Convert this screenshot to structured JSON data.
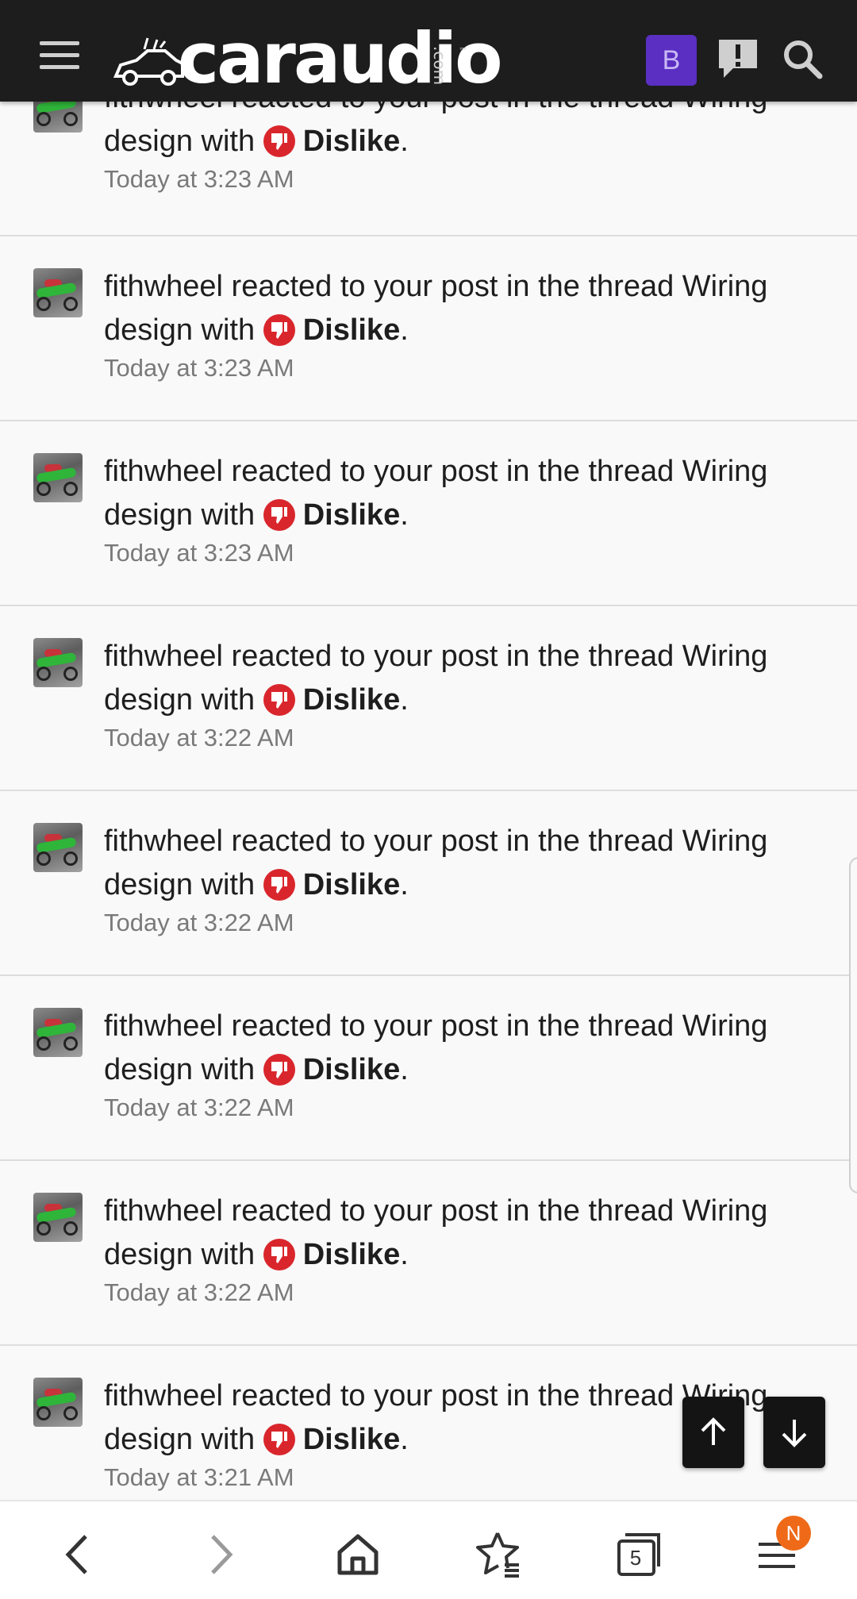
{
  "header": {
    "logo_text": "caraudio",
    "logo_suffix": ".com",
    "logo_tm": "™",
    "user_initial": "B",
    "icons": [
      "menu-icon",
      "alert-icon",
      "search-icon"
    ]
  },
  "notifications": [
    {
      "text": "fithwheel reacted to your post in the thread Wiring design with",
      "reaction": "Dislike",
      "time": "Today at 3:23 AM"
    },
    {
      "text": "fithwheel reacted to your post in the thread Wiring design with",
      "reaction": "Dislike",
      "time": "Today at 3:23 AM"
    },
    {
      "text": "fithwheel reacted to your post in the thread Wiring design with",
      "reaction": "Dislike",
      "time": "Today at 3:23 AM"
    },
    {
      "text": "fithwheel reacted to your post in the thread Wiring design with",
      "reaction": "Dislike",
      "time": "Today at 3:22 AM"
    },
    {
      "text": "fithwheel reacted to your post in the thread Wiring design with",
      "reaction": "Dislike",
      "time": "Today at 3:22 AM"
    },
    {
      "text": "fithwheel reacted to your post in the thread Wiring design with",
      "reaction": "Dislike",
      "time": "Today at 3:22 AM"
    },
    {
      "text": "fithwheel reacted to your post in the thread Wiring design with",
      "reaction": "Dislike",
      "time": "Today at 3:22 AM"
    },
    {
      "text": "fithwheel reacted to your post in the thread Wiring design with",
      "reaction": "Dislike",
      "time": "Today at 3:21 AM"
    }
  ],
  "bottombar": {
    "tab_count": "5",
    "menu_badge": "N"
  },
  "colors": {
    "header_bg": "#1d1d1d",
    "avatar_bg": "#5a2fc2",
    "dislike_red": "#d9262c",
    "badge_orange": "#ef6a18"
  }
}
